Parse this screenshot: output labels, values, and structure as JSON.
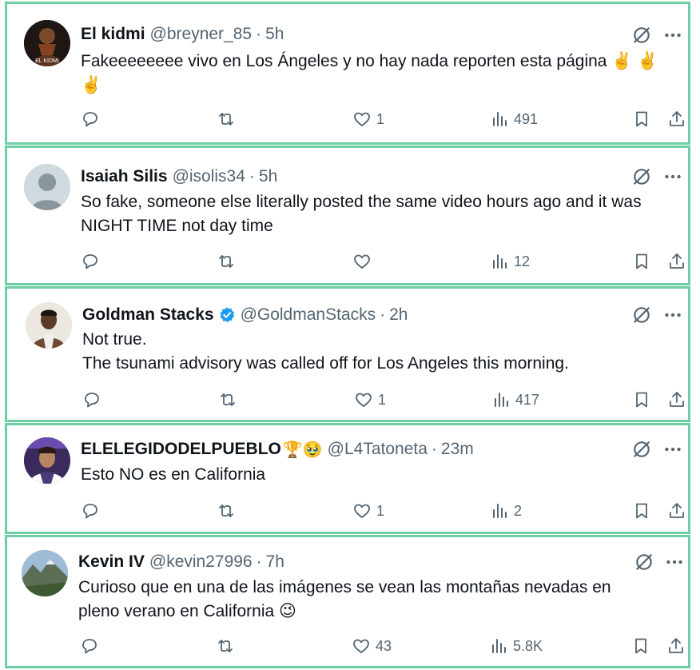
{
  "colors": {
    "border": "#6fcfa4",
    "icon": "#536471",
    "verified": "#1d9bf0"
  },
  "tweets": [
    {
      "name": "El kidmi",
      "handle": "@breyner_85",
      "time": "5h",
      "text": "Fakeeeeeeee vivo en Los Ángeles y no hay nada reporten esta página ✌️ ✌️\n✌️",
      "avatar_text": "EL KIDMI",
      "replies": "",
      "retweets": "",
      "likes": "1",
      "views": "491"
    },
    {
      "name": "Isaiah Silis",
      "handle": "@isolis34",
      "time": "5h",
      "text": "So fake, someone else literally posted the same video hours ago and it was\nNIGHT TIME not day time",
      "replies": "",
      "retweets": "",
      "likes": "",
      "views": "12"
    },
    {
      "name": "Goldman Stacks",
      "handle": "@GoldmanStacks",
      "time": "2h",
      "verified": true,
      "text": "Not true.\nThe tsunami advisory was called off for Los Angeles this morning.",
      "replies": "",
      "retweets": "",
      "likes": "1",
      "views": "417"
    },
    {
      "name": "ELELEGIDODELPUEBLO",
      "name_emoji": "🏆🥹",
      "handle": "@L4Tatoneta",
      "time": "23m",
      "text": "Esto NO es en California",
      "replies": "",
      "retweets": "",
      "likes": "1",
      "views": "2"
    },
    {
      "name": "Kevin IV",
      "handle": "@kevin27996",
      "time": "7h",
      "text": "Curioso que en una de las imágenes se vean las montañas nevadas en\npleno verano en California 😉",
      "replies": "",
      "retweets": "",
      "likes": "43",
      "views": "5.8K"
    }
  ],
  "icons": {
    "reply": "reply-icon",
    "retweet": "retweet-icon",
    "like": "heart-icon",
    "views": "views-icon",
    "bookmark": "bookmark-icon",
    "share": "share-icon",
    "grok": "grok-icon",
    "more": "more-icon"
  },
  "separator": "·"
}
